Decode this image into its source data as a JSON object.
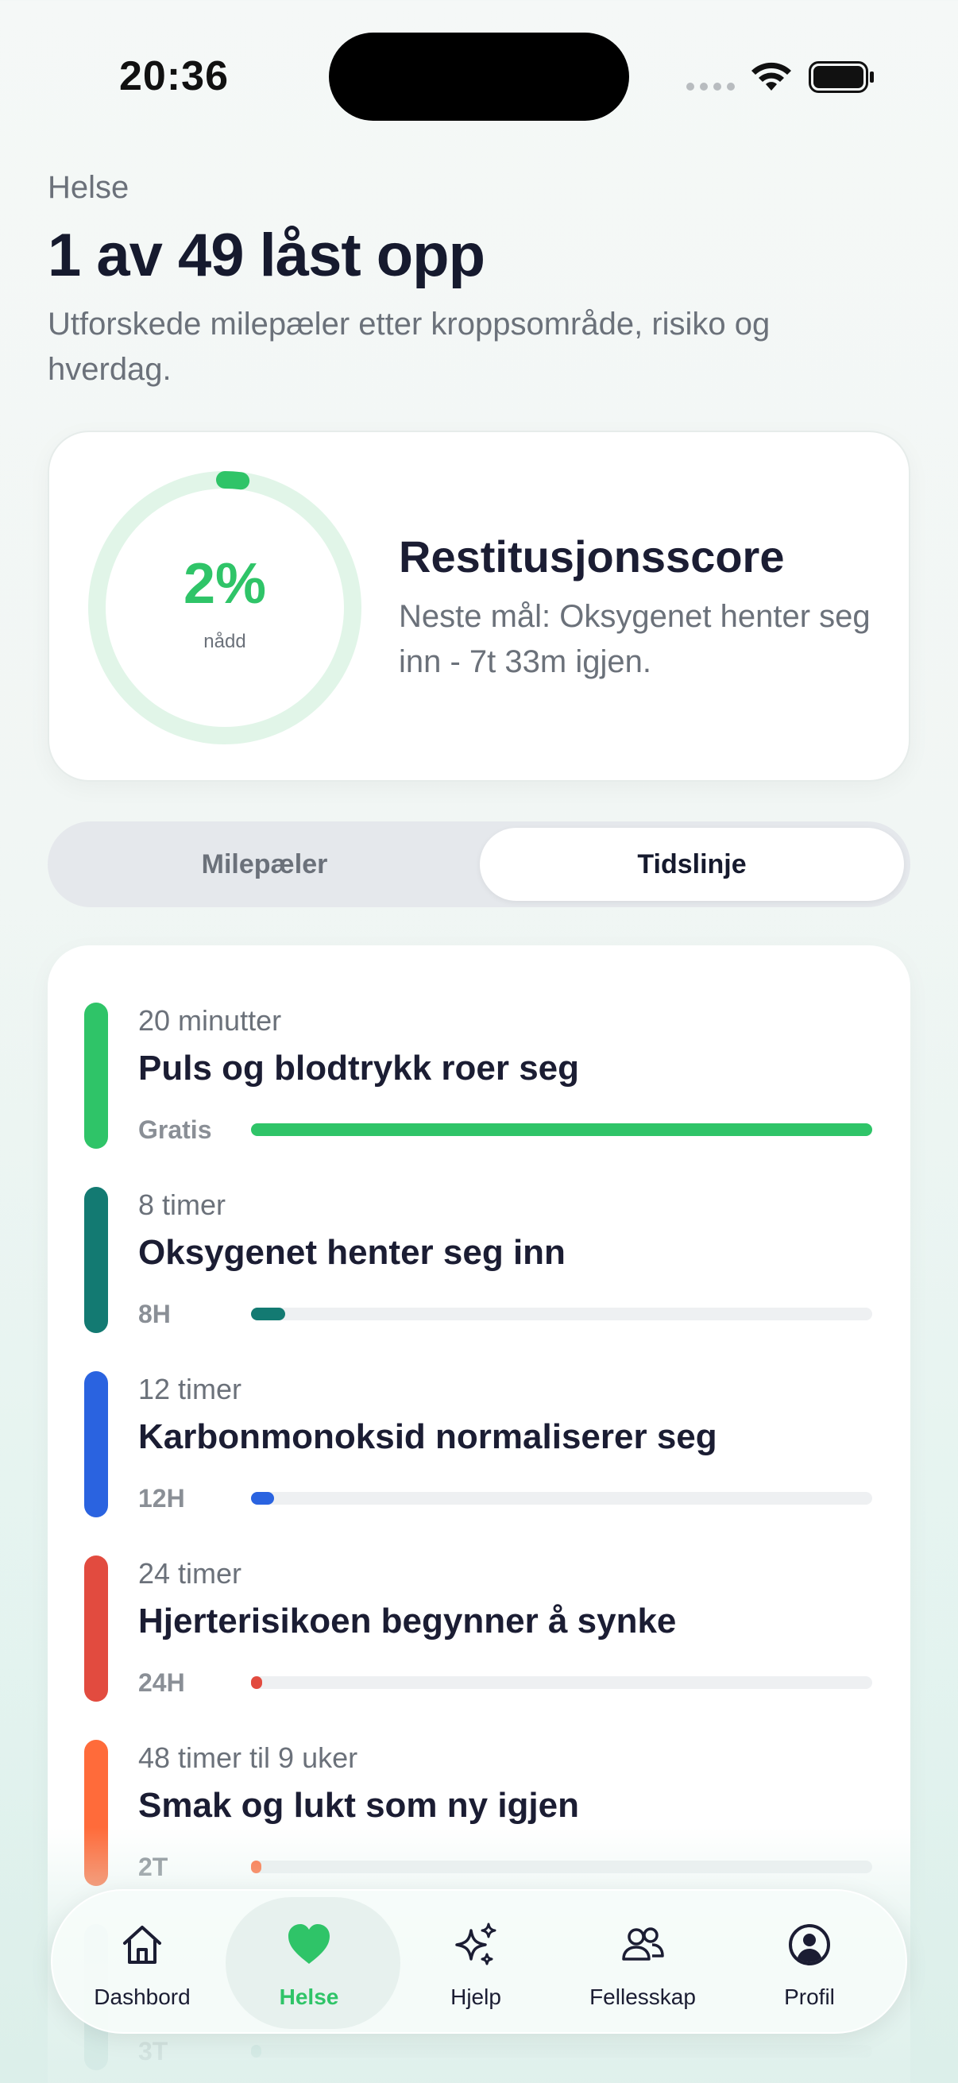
{
  "status_bar": {
    "time": "20:36"
  },
  "header": {
    "eyebrow": "Helse",
    "title": "1 av 49 låst opp",
    "subtitle": "Utforskede milepæler etter kroppsområde, risiko og hverdag."
  },
  "score_card": {
    "percent_label": "2%",
    "percent_value": 2,
    "ring_sub": "nådd",
    "title": "Restitusjonsscore",
    "description": "Neste mål: Oksygenet henter seg inn - 7t 33m igjen.",
    "accent": "#2fc468"
  },
  "segmented": {
    "left": "Milepæler",
    "right": "Tidslinje",
    "selected": "Tidslinje"
  },
  "milestones": [
    {
      "when": "20 minutter",
      "title": "Puls og blodtrykk roer seg",
      "tag": "Gratis",
      "color": "#2fc468",
      "progress": 1.0
    },
    {
      "when": "8 timer",
      "title": "Oksygenet henter seg inn",
      "tag": "8H",
      "color": "#137a72",
      "progress": 0.055
    },
    {
      "when": "12 timer",
      "title": "Karbonmonoksid normaliserer seg",
      "tag": "12H",
      "color": "#2a63e0",
      "progress": 0.037
    },
    {
      "when": "24 timer",
      "title": "Hjerterisikoen begynner å synke",
      "tag": "24H",
      "color": "#e24b3f",
      "progress": 0.018
    },
    {
      "when": "48 timer til 9 uker",
      "title": "Smak og lukt som ny igjen",
      "tag": "2T",
      "color": "#ff6b3a",
      "progress": 0.009
    },
    {
      "when": "",
      "title": "",
      "tag": "3T",
      "color": "#9fc7c3",
      "progress": 0.005
    }
  ],
  "tabbar": {
    "items": [
      {
        "label": "Dashbord",
        "icon": "home-icon"
      },
      {
        "label": "Helse",
        "icon": "heart-icon"
      },
      {
        "label": "Hjelp",
        "icon": "sparkles-icon"
      },
      {
        "label": "Fellesskap",
        "icon": "people-icon"
      },
      {
        "label": "Profil",
        "icon": "profile-icon"
      }
    ],
    "active": "Helse"
  }
}
